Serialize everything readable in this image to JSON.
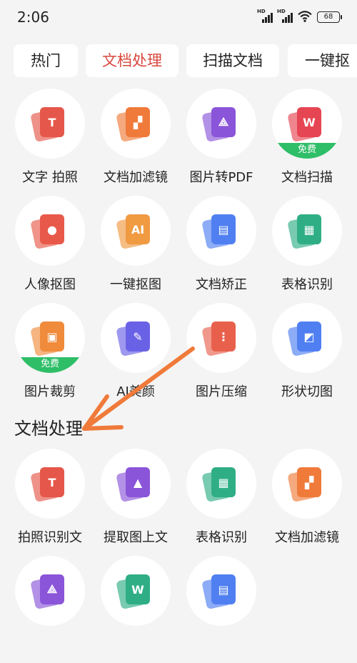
{
  "status": {
    "time": "2:06",
    "battery": "68",
    "hd1": "HD",
    "hd2": "HD"
  },
  "tabs": [
    {
      "label": "热门"
    },
    {
      "label": "文档处理"
    },
    {
      "label": "扫描文档"
    },
    {
      "label": "一键抠"
    }
  ],
  "grid": [
    {
      "label": "文字  拍照",
      "icon": "photo-text-icon",
      "color": "#e5574a"
    },
    {
      "label": "文档加滤镜",
      "icon": "filter-icon",
      "color": "#f07a3a"
    },
    {
      "label": "图片转PDF",
      "icon": "pdf-icon",
      "color": "#8a55d9"
    },
    {
      "label": "文档扫描",
      "icon": "word-scan-icon",
      "color": "#e64553",
      "badge": "免费"
    },
    {
      "label": "人像抠图",
      "icon": "portrait-icon",
      "color": "#e8594a"
    },
    {
      "label": "一键抠图",
      "icon": "ai-cutout-icon",
      "color": "#f09a42"
    },
    {
      "label": "文档矫正",
      "icon": "doc-correct-icon",
      "color": "#4f7ff1"
    },
    {
      "label": "表格识别",
      "icon": "table-icon",
      "color": "#2fae86"
    },
    {
      "label": "图片裁剪",
      "icon": "crop-icon",
      "color": "#f08b3c",
      "badge": "免费"
    },
    {
      "label": "AI美颜",
      "icon": "beauty-brush-icon",
      "color": "#6a62e6"
    },
    {
      "label": "图片压缩",
      "icon": "zip-icon",
      "color": "#e8604c"
    },
    {
      "label": "形状切图",
      "icon": "shape-cut-icon",
      "color": "#4f7ff1"
    }
  ],
  "section": {
    "title": "文档处理"
  },
  "section_grid": [
    {
      "label": "拍照识别文",
      "icon": "photo-text-icon",
      "color": "#e5574a"
    },
    {
      "label": "提取图上文",
      "icon": "image-text-icon",
      "color": "#8a55d9"
    },
    {
      "label": "表格识别",
      "icon": "table-icon",
      "color": "#2fae86"
    },
    {
      "label": "文档加滤镜",
      "icon": "filter-icon",
      "color": "#f07a3a"
    },
    {
      "label": "",
      "icon": "pdf-icon",
      "color": "#8a55d9"
    },
    {
      "label": "",
      "icon": "word-icon",
      "color": "#2fae86"
    },
    {
      "label": "",
      "icon": "doc-icon",
      "color": "#4f7ff1"
    }
  ]
}
